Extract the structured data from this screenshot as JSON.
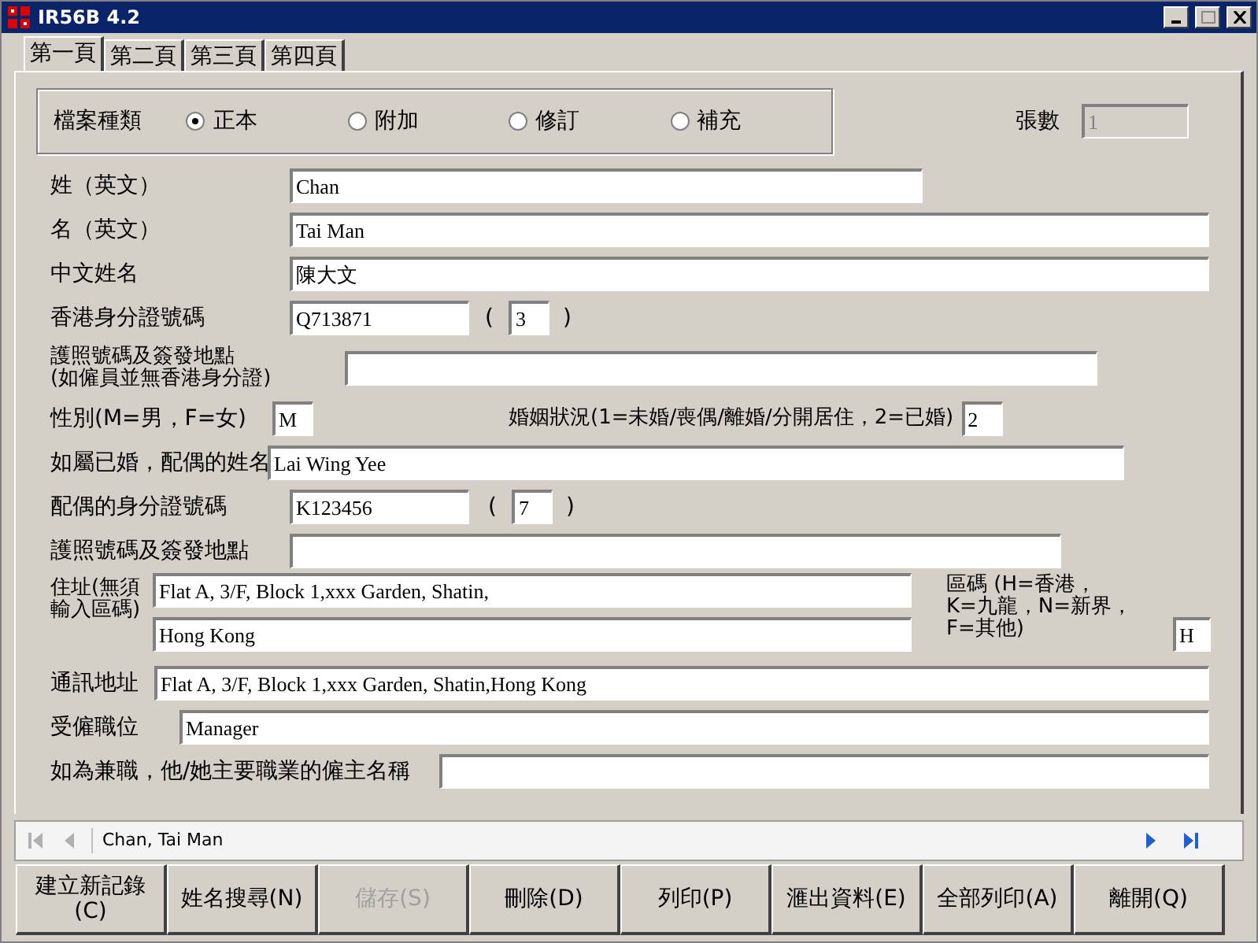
{
  "window": {
    "title": "IR56B 4.2"
  },
  "tabs": [
    {
      "label": "第一頁",
      "selected": true
    },
    {
      "label": "第二頁",
      "selected": false
    },
    {
      "label": "第三頁",
      "selected": false
    },
    {
      "label": "第四頁",
      "selected": false
    }
  ],
  "file_type": {
    "label": "檔案種類",
    "options": [
      {
        "label": "正本",
        "selected": true
      },
      {
        "label": "附加",
        "selected": false
      },
      {
        "label": "修訂",
        "selected": false
      },
      {
        "label": "補充",
        "selected": false
      }
    ]
  },
  "sheet_count": {
    "label": "張數",
    "value": "1",
    "disabled": true
  },
  "surname": {
    "label": "姓（英文）",
    "value": "Chan"
  },
  "given_name": {
    "label": "名（英文）",
    "value": "Tai Man"
  },
  "chinese_name": {
    "label": "中文姓名",
    "value": "陳大文"
  },
  "hkid": {
    "label": "香港身分證號碼",
    "value": "Q713871",
    "open": "(",
    "check_digit": "3",
    "close": ")"
  },
  "passport": {
    "label_lines": [
      "護照號碼及簽發地點",
      "(如僱員並無香港身分證)"
    ]
  },
  "sex": {
    "label": "性別(M=男，F=女)",
    "value": "M"
  },
  "marital_status": {
    "label": "婚姻狀況(1=未婚/喪偶/離婚/分開居住，2=已婚)",
    "value": "2"
  },
  "spouse_name": {
    "label": "如屬已婚，配偶的姓名",
    "value": "Lai Wing Yee"
  },
  "spouse_id": {
    "label": "配偶的身分證號碼",
    "value": "K123456",
    "open": "(",
    "check_digit": "7",
    "close": ")"
  },
  "spouse_passport": {
    "label": "護照號碼及簽發地點"
  },
  "address": {
    "label_lines": [
      "住址(無須",
      "輸入區碼)"
    ],
    "line_1": "Flat A, 3/F, Block 1,xxx Garden, Shatin,",
    "line_2": "Hong Kong",
    "area_label_lines": [
      "區碼 (H=香港，",
      "K=九龍，N=新界，",
      "F=其他)"
    ],
    "area_code": "H"
  },
  "postal_address": {
    "label": "通訊地址",
    "value": "Flat A, 3/F, Block 1,xxx Garden, Shatin,Hong Kong"
  },
  "position": {
    "label": "受僱職位",
    "value": "Manager"
  },
  "principal_employer": {
    "label": "如為兼職，他/她主要職業的僱主名稱"
  },
  "navigator": {
    "record": "Chan, Tai Man"
  },
  "buttons": [
    {
      "label": "建立新記錄\n(C)",
      "disabled": false
    },
    {
      "label": "姓名搜尋(N)",
      "disabled": false
    },
    {
      "label": "儲存(S)",
      "disabled": true
    },
    {
      "label": "刪除(D)",
      "disabled": false
    },
    {
      "label": "列印(P)",
      "disabled": false
    },
    {
      "label": "滙出資料(E)",
      "disabled": false
    },
    {
      "label": "全部列印(A)",
      "disabled": false
    },
    {
      "label": "離開(Q)",
      "disabled": false
    }
  ]
}
